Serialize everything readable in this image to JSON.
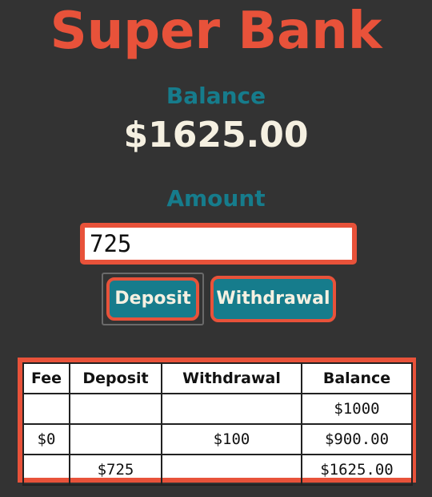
{
  "app": {
    "title": "Super Bank"
  },
  "balance": {
    "label": "Balance",
    "value": "$1625.00"
  },
  "amount": {
    "label": "Amount",
    "value": "725"
  },
  "buttons": {
    "deposit_label": "Deposit",
    "withdrawal_label": "Withdrawal"
  },
  "ledger": {
    "headers": [
      "Fee",
      "Deposit",
      "Withdrawal",
      "Balance"
    ],
    "rows": [
      [
        "",
        "",
        "",
        "$1000"
      ],
      [
        "$0",
        "",
        "$100",
        "$900.00"
      ],
      [
        "",
        "$725",
        "",
        "$1625.00"
      ]
    ]
  },
  "colors": {
    "background": "#333333",
    "accent": "#e8523a",
    "teal": "#167c8c",
    "cream": "#f5f0e1"
  }
}
